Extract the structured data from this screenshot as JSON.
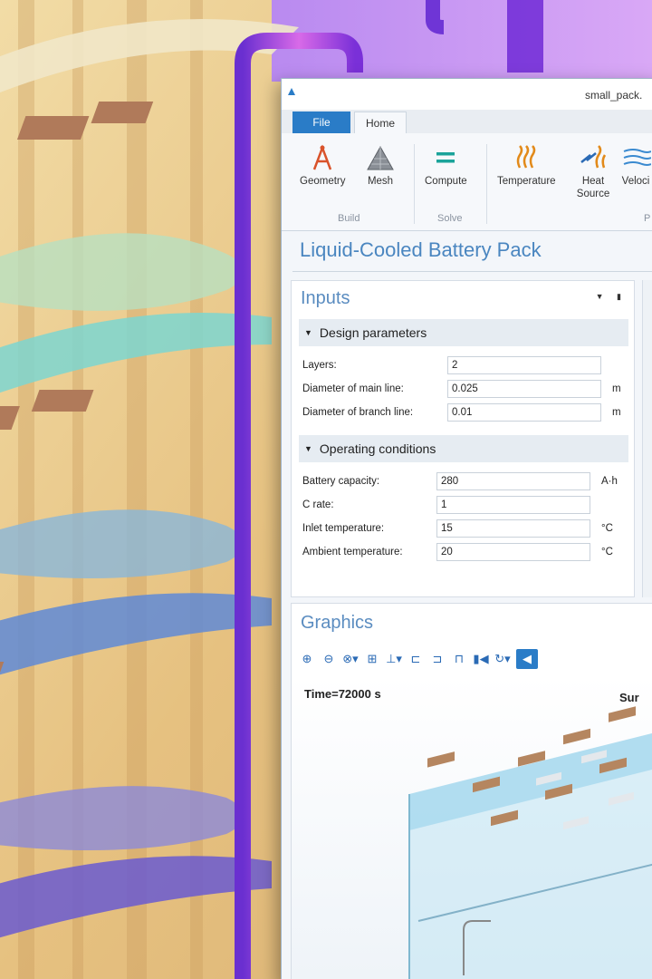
{
  "window": {
    "title": "small_pack."
  },
  "tabs": {
    "file": "File",
    "home": "Home"
  },
  "ribbon": {
    "geometry": "Geometry",
    "mesh": "Mesh",
    "compute": "Compute",
    "temperature": "Temperature",
    "heat_source": "Heat Source",
    "velocity": "Veloci",
    "groups": {
      "build": "Build",
      "solve": "Solve",
      "partial": "P"
    }
  },
  "app_title": "Liquid-Cooled Battery Pack",
  "inputs": {
    "header": "Inputs",
    "design_section": "Design parameters",
    "layers_label": "Layers:",
    "layers_value": "2",
    "main_line_label": "Diameter of main line:",
    "main_line_value": "0.025",
    "main_line_unit": "m",
    "branch_line_label": "Diameter of branch line:",
    "branch_line_value": "0.01",
    "branch_line_unit": "m",
    "operating_section": "Operating conditions",
    "capacity_label": "Battery capacity:",
    "capacity_value": "280",
    "capacity_unit": "A·h",
    "crate_label": "C rate:",
    "crate_value": "1",
    "inlet_label": "Inlet temperature:",
    "inlet_value": "15",
    "inlet_unit": "°C",
    "ambient_label": "Ambient temperature:",
    "ambient_value": "20",
    "ambient_unit": "°C"
  },
  "graphics": {
    "header": "Graphics",
    "time_label": "Time=72000 s",
    "surface_label": "Sur"
  },
  "colors": {
    "accent": "#2a7cc7",
    "panel_title": "#5a8cc0",
    "pipe": "#8a3fe0"
  }
}
